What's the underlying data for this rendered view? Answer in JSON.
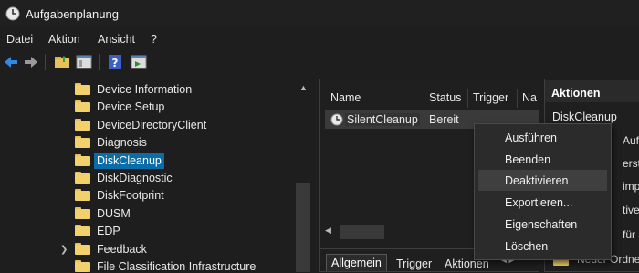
{
  "window": {
    "title": "Aufgabenplanung"
  },
  "menu": [
    "Datei",
    "Aktion",
    "Ansicht",
    "?"
  ],
  "tree": {
    "items": [
      {
        "label": "Device Information"
      },
      {
        "label": "Device Setup"
      },
      {
        "label": "DeviceDirectoryClient"
      },
      {
        "label": "Diagnosis"
      },
      {
        "label": "DiskCleanup",
        "selected": true
      },
      {
        "label": "DiskDiagnostic"
      },
      {
        "label": "DiskFootprint"
      },
      {
        "label": "DUSM"
      },
      {
        "label": "EDP"
      },
      {
        "label": "Feedback",
        "expandable": true
      },
      {
        "label": "File Classification Infrastructure"
      }
    ]
  },
  "tasks": {
    "columns": [
      "Name",
      "Status",
      "Trigger",
      "Na"
    ],
    "rows": [
      {
        "name": "SilentCleanup",
        "status": "Bereit"
      }
    ]
  },
  "bottom_tabs": [
    "Allgemein",
    "Trigger",
    "Aktionen"
  ],
  "actions": {
    "title": "Aktionen",
    "items": [
      "DiskCleanup"
    ],
    "fragments": [
      "Aufg",
      "erst",
      "imp",
      "tive",
      "für a"
    ],
    "folder_label": "Neuer Ordner"
  },
  "context_menu": {
    "items": [
      "Ausführen",
      "Beenden",
      "Deaktivieren",
      "Exportieren...",
      "Eigenschaften",
      "Löschen"
    ],
    "hover_index": 2
  },
  "colors": {
    "selection": "#0a6da9",
    "folder": "#f2d06b",
    "background": "#1e1e1e"
  }
}
